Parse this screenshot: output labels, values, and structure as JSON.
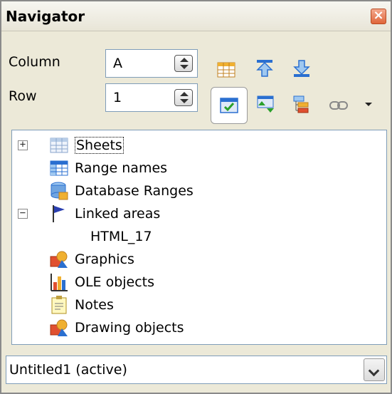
{
  "window": {
    "title": "Navigator",
    "close_icon": "close-icon"
  },
  "position": {
    "column_label": "Column",
    "column_value": "A",
    "row_label": "Row",
    "row_value": "1"
  },
  "toolbar": {
    "icons": [
      "data-range-icon",
      "start-icon",
      "end-icon",
      "contents-toggle-icon",
      "drag-mode-icon",
      "scenarios-icon",
      "link-icon",
      "dropdown-arrow-icon"
    ]
  },
  "tree": {
    "items": [
      {
        "label": "Sheets",
        "icon": "sheets-icon",
        "expander": "+"
      },
      {
        "label": "Range names",
        "icon": "range-names-icon"
      },
      {
        "label": "Database Ranges",
        "icon": "database-icon"
      },
      {
        "label": "Linked areas",
        "icon": "flag-icon",
        "expander": "−"
      },
      {
        "label": "HTML_17"
      },
      {
        "label": "Graphics",
        "icon": "graphics-icon"
      },
      {
        "label": "OLE objects",
        "icon": "ole-icon"
      },
      {
        "label": "Notes",
        "icon": "notes-icon"
      },
      {
        "label": "Drawing objects",
        "icon": "drawing-icon"
      }
    ]
  },
  "document": {
    "selected": "Untitled1 (active)"
  },
  "colors": {
    "accent_blue": "#2a6fd0",
    "close_red": "#e0663a",
    "panel_bg": "#ece9d8"
  }
}
